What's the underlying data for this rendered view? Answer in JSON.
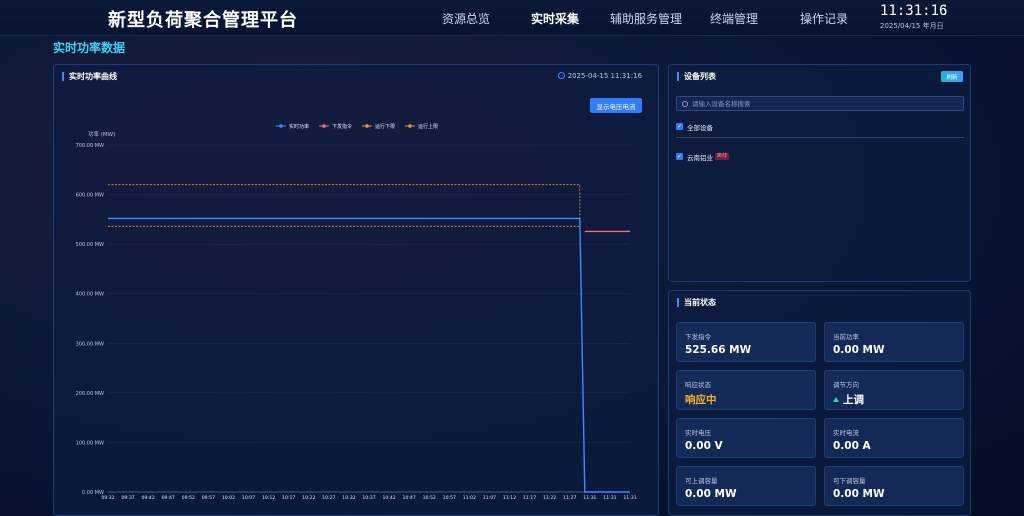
{
  "app": {
    "title": "新型负荷聚合管理平台",
    "nav": [
      "资源总览",
      "实时采集",
      "辅助服务管理",
      "终端管理",
      "操作记录"
    ],
    "active_nav": "实时采集",
    "clock": "11:31:16",
    "date": "2025/04/15 年月日"
  },
  "page_title": "实时功率数据",
  "chart_panel": {
    "title": "实时功率曲线",
    "timestamp": "2025-04-15 11:31:16",
    "button_label": "显示电压电流"
  },
  "chart_data": {
    "type": "line",
    "ylabel": "功率 (MW)",
    "y_ticks": [
      "0.00 MW",
      "100.00 MW",
      "200.00 MW",
      "300.00 MW",
      "400.00 MW",
      "500.00 MW",
      "600.00 MW",
      "700.00 MW"
    ],
    "ylim": [
      0,
      700
    ],
    "x_ticks": [
      "09:32",
      "09:37",
      "09:42",
      "09:47",
      "09:52",
      "09:57",
      "10:02",
      "10:07",
      "10:12",
      "10:17",
      "10:22",
      "10:27",
      "10:32",
      "10:37",
      "10:42",
      "10:47",
      "10:52",
      "10:57",
      "11:02",
      "11:07",
      "11:12",
      "11:17",
      "11:22",
      "11:27",
      "11:31",
      "11:31",
      "11:31"
    ],
    "grid": true,
    "legend_position": "top",
    "series": [
      {
        "name": "实时功率",
        "color": "#3a8cff",
        "style": "solid",
        "points": [
          [
            0,
            552
          ],
          [
            23.5,
            552
          ],
          [
            23.75,
            0
          ],
          [
            26,
            0
          ]
        ]
      },
      {
        "name": "下发指令",
        "color": "#ff6b7a",
        "style": "solid",
        "points": [
          [
            23.75,
            525.66
          ],
          [
            26,
            525.66
          ]
        ]
      },
      {
        "name": "运行下限",
        "color": "#f0932b",
        "style": "dashed",
        "points": [
          [
            0,
            536
          ],
          [
            23.5,
            536
          ]
        ]
      },
      {
        "name": "运行上限",
        "color": "#f0932b",
        "style": "dashed",
        "points": [
          [
            0,
            620
          ],
          [
            23.5,
            620
          ],
          [
            23.5,
            552
          ]
        ]
      }
    ]
  },
  "device_panel": {
    "title": "设备列表",
    "refresh_label": "刷新",
    "search_placeholder": "请输入设备名称搜索",
    "all_devices_label": "全部设备",
    "devices": [
      {
        "name": "云南铝业",
        "badge": "离线"
      }
    ]
  },
  "status_panel": {
    "title": "当前状态",
    "cards": [
      {
        "label": "下发指令",
        "value": "525.66 MW"
      },
      {
        "label": "当前功率",
        "value": "0.00 MW"
      },
      {
        "label": "响应状态",
        "value": "响应中"
      },
      {
        "label": "调节方向",
        "value": "上调"
      },
      {
        "label": "实时电压",
        "value": "0.00 V"
      },
      {
        "label": "实时电流",
        "value": "0.00 A"
      },
      {
        "label": "可上调容量",
        "value": "0.00 MW"
      },
      {
        "label": "可下调容量",
        "value": "0.00 MW"
      }
    ]
  }
}
